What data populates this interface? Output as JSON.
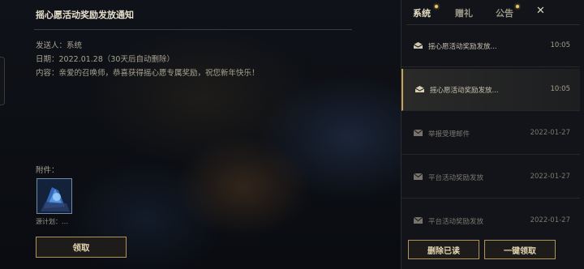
{
  "message": {
    "title": "摇心愿活动奖励发放通知",
    "sender": "发送人：系统",
    "date": "日期：2022.01.28（30天后自动删除）",
    "content": "内容：亲爱的召唤师，恭喜获得摇心愿专属奖励，祝您新年快乐！",
    "attachment_label": "附件：",
    "attachment_name": "源计划：…",
    "claim_label": "领取"
  },
  "panel": {
    "tabs": [
      {
        "label": "系统"
      },
      {
        "label": "赠礼"
      },
      {
        "label": "公告"
      }
    ],
    "close_symbol": "✕",
    "mails": [
      {
        "subject": "摇心愿活动奖励发放...",
        "time": "10:05"
      },
      {
        "subject": "摇心愿活动奖励发放...",
        "time": "10:05"
      },
      {
        "subject": "举报受理邮件",
        "time": "2022-01-27"
      },
      {
        "subject": "平台活动奖励发放",
        "time": "2022-01-27"
      },
      {
        "subject": "平台活动奖励发放",
        "time": "2022-01-27"
      }
    ],
    "delete_read_label": "删除已读",
    "claim_all_label": "一键领取"
  },
  "colors": {
    "accent_gold": "#b09356",
    "notice_dot": "#e7c56b",
    "background": "#0b0d12"
  },
  "icons": {
    "mail_opened": "mail-open-icon",
    "mail_closed": "mail-icon",
    "close": "close-icon"
  }
}
